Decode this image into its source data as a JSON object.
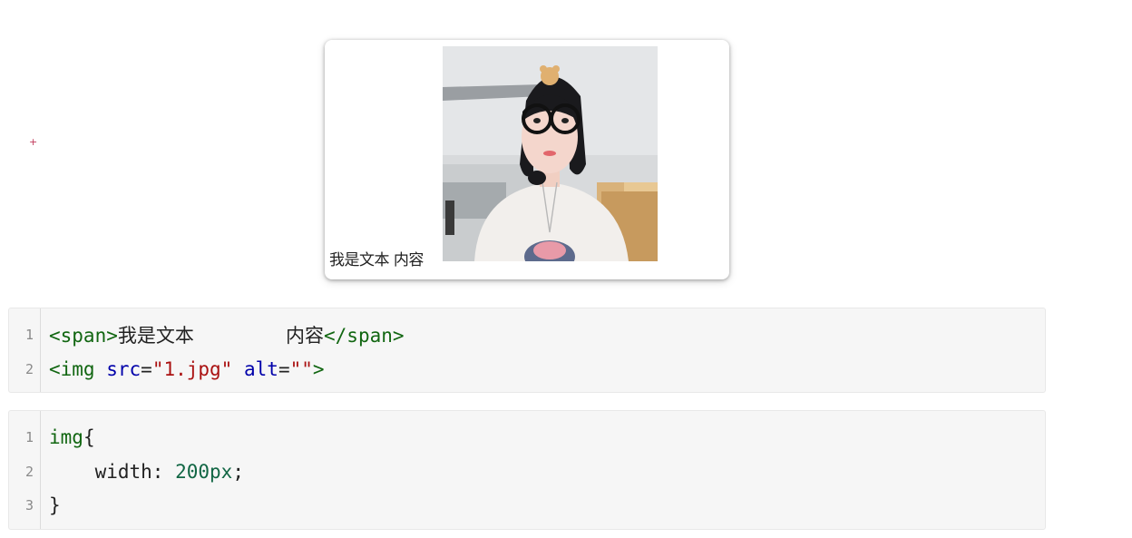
{
  "marker": {
    "symbol": "+"
  },
  "demo": {
    "text_label": "我是文本 内容",
    "image_alt": ""
  },
  "html_code": {
    "lines": [
      {
        "number": "1",
        "open_tag": "<span>",
        "text_a": "我是文本",
        "gap": "        ",
        "text_b": "内容",
        "close_tag": "</span>"
      },
      {
        "number": "2",
        "tag_open": "<img",
        "attr_src": "src",
        "equals1": "=",
        "src_value": "\"1.jpg\"",
        "attr_alt": "alt",
        "equals2": "=",
        "alt_value": "\"\"",
        "tag_close": ">"
      }
    ]
  },
  "css_code": {
    "lines": [
      {
        "number": "1",
        "selector": "img",
        "brace": "{"
      },
      {
        "number": "2",
        "indent": "    ",
        "property": "width: ",
        "value": "200px",
        "semicolon": ";"
      },
      {
        "number": "3",
        "brace": "}"
      }
    ]
  }
}
